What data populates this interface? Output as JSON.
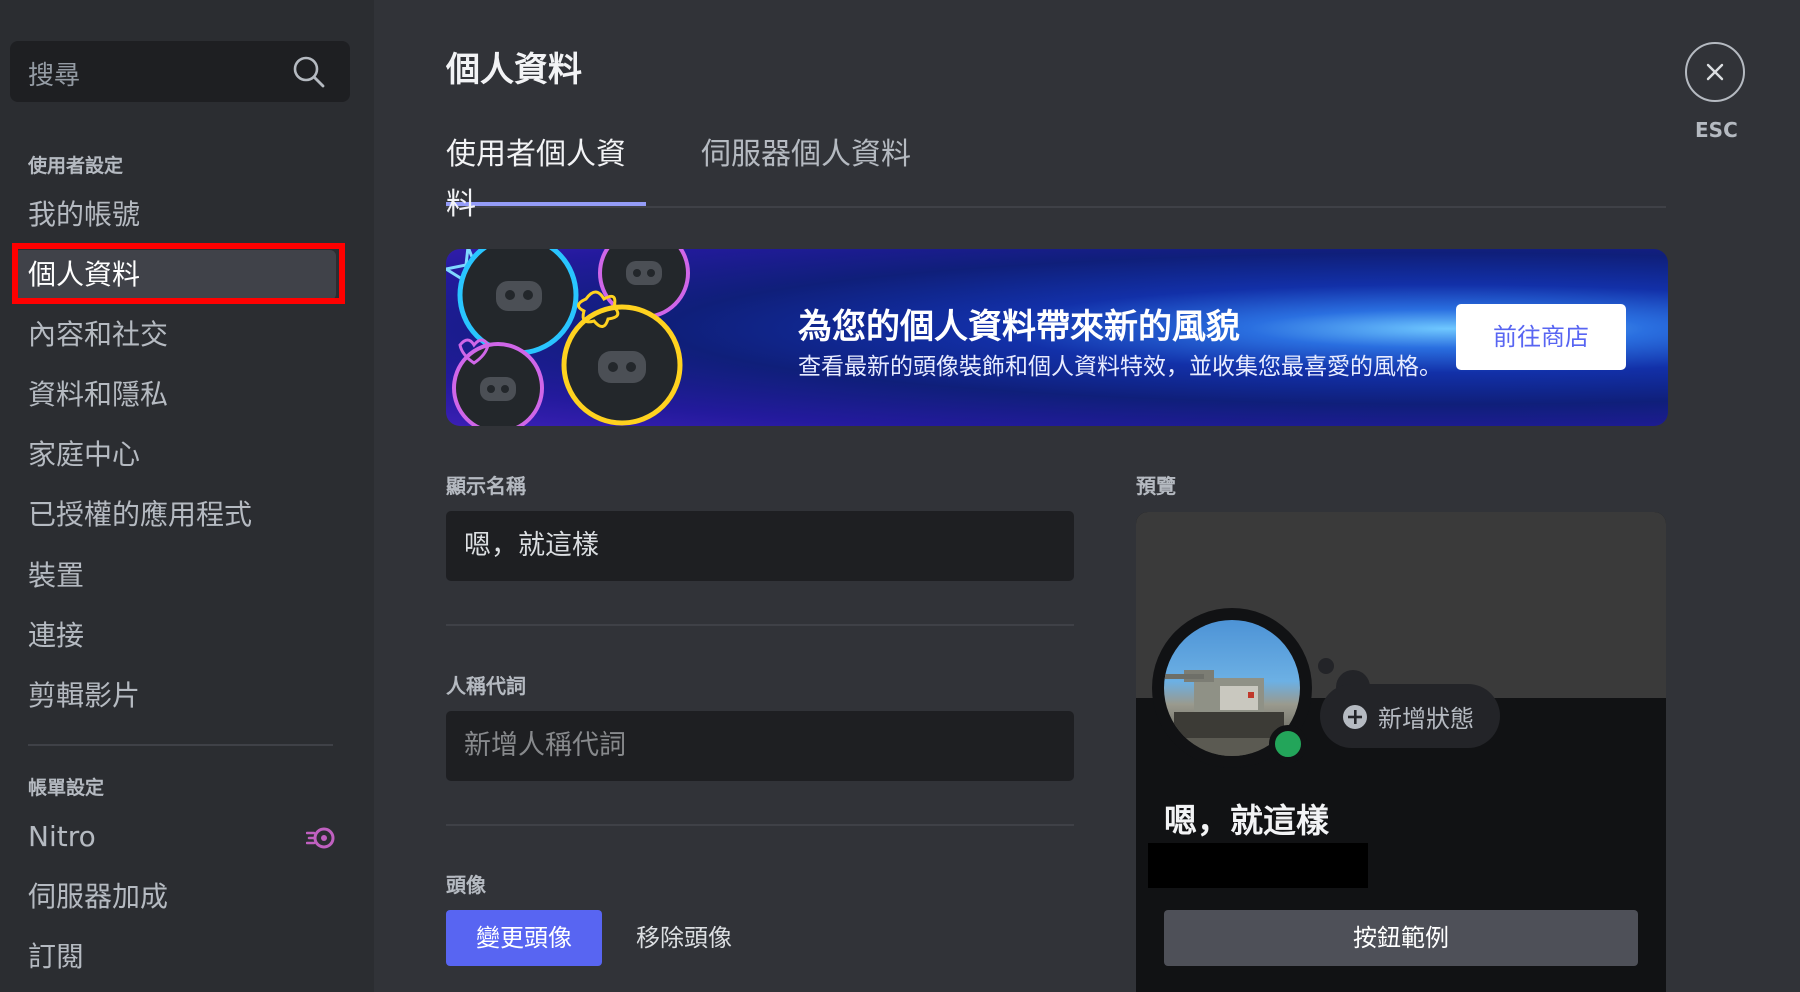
{
  "sidebar": {
    "search_placeholder": "搜尋",
    "sections": [
      {
        "header": "使用者設定",
        "items": [
          {
            "label": "我的帳號"
          },
          {
            "label": "個人資料"
          },
          {
            "label": "內容和社交"
          },
          {
            "label": "資料和隱私"
          },
          {
            "label": "家庭中心"
          },
          {
            "label": "已授權的應用程式"
          },
          {
            "label": "裝置"
          },
          {
            "label": "連接"
          },
          {
            "label": "剪輯影片"
          }
        ]
      },
      {
        "header": "帳單設定",
        "items": [
          {
            "label": "Nitro"
          },
          {
            "label": "伺服器加成"
          },
          {
            "label": "訂閱"
          }
        ]
      }
    ],
    "selected": "個人資料"
  },
  "main": {
    "title": "個人資料",
    "tabs": [
      {
        "label": "使用者個人資料"
      },
      {
        "label": "伺服器個人資料"
      }
    ],
    "banner": {
      "title": "為您的個人資料帶來新的風貌",
      "subtitle": "查看最新的頭像裝飾和個人資料特效，並收集您最喜愛的風格。",
      "button": "前往商店"
    },
    "display_name": {
      "label": "顯示名稱",
      "value": "嗯，就這樣"
    },
    "pronouns": {
      "label": "人稱代詞",
      "placeholder": "新增人稱代詞"
    },
    "avatar": {
      "label": "頭像",
      "change_button": "變更頭像",
      "remove_button": "移除頭像"
    },
    "preview": {
      "label": "預覽",
      "add_status": "新增狀態",
      "name": "嗯，就這樣",
      "example_button": "按鈕範例"
    },
    "close": {
      "label": "ESC"
    }
  },
  "colors": {
    "accent": "#5865f2",
    "online": "#23a55a",
    "highlight": "#ff0000",
    "nitro": "#c060c0"
  }
}
